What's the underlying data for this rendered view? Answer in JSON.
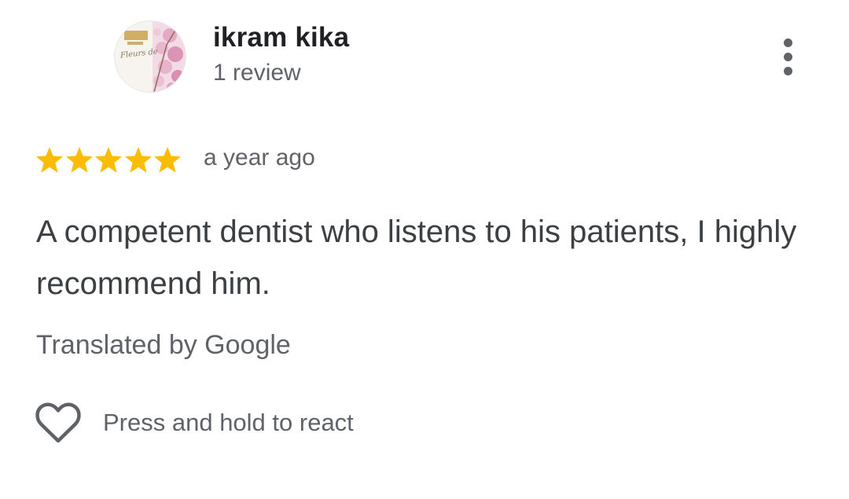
{
  "review": {
    "author": {
      "name": "ikram kika",
      "review_count": "1 review",
      "avatar_script": "Fleurs de",
      "avatar_icon": "profile-photo-cherry-blossom"
    },
    "rating": {
      "stars": 5,
      "max": 5,
      "color": "#fbbc04"
    },
    "date": "a year ago",
    "text": "A competent dentist who listens to his patients, I highly recommend him.",
    "translated_label": "Translated by Google",
    "react_label": "Press and hold to react",
    "icons": {
      "more": "more-vert-icon",
      "react": "heart-outline-icon",
      "star": "star-icon"
    }
  }
}
